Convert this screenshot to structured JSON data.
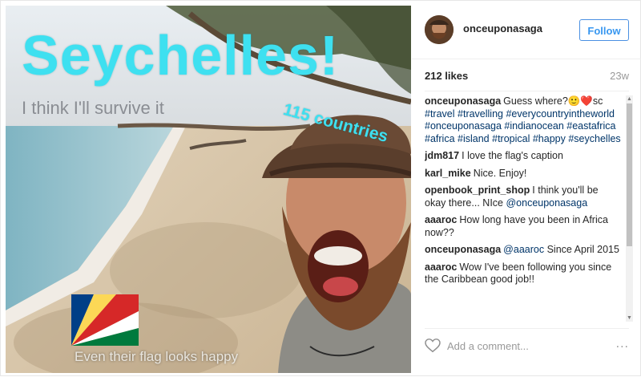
{
  "photo": {
    "title": "Seychelles!",
    "subtitle": "I think I'll survive it",
    "countries": "115 countries",
    "flag_caption": "Even their flag looks happy",
    "flag_colors": [
      "#003f87",
      "#fcd856",
      "#d62828",
      "#ffffff",
      "#007a3d"
    ]
  },
  "header": {
    "username": "onceuponasaga",
    "follow_label": "Follow"
  },
  "stats": {
    "likes": "212 likes",
    "time": "23w"
  },
  "comments": [
    {
      "user": "onceuponasaga",
      "text": "Guess where?🙂❤️sc #travel #travelling #everycountryintheworld #onceuponasaga #indianocean #eastafrica #africa #island #tropical #happy #seychelles"
    },
    {
      "user": "jdm817",
      "text": "I love the flag's caption"
    },
    {
      "user": "karl_mike",
      "text": "Nice. Enjoy!"
    },
    {
      "user": "openbook_print_shop",
      "text": "I think you'll be okay there... NIce @onceuponasaga"
    },
    {
      "user": "aaaroc",
      "text": "How long have you been in Africa now??"
    },
    {
      "user": "onceuponasaga",
      "text": "@aaaroc Since April 2015"
    },
    {
      "user": "aaaroc",
      "text": "Wow I've been following you since the Caribbean good job!!"
    }
  ],
  "footer": {
    "placeholder": "Add a comment...",
    "more_label": "..."
  },
  "icons": {
    "like": "heart-icon",
    "more": "more-options-icon",
    "scroll_up": "▲",
    "scroll_down": "▼"
  },
  "colors": {
    "accent": "#3897f0",
    "title_cyan": "#3ee0f0",
    "hashtag": "#003569"
  }
}
